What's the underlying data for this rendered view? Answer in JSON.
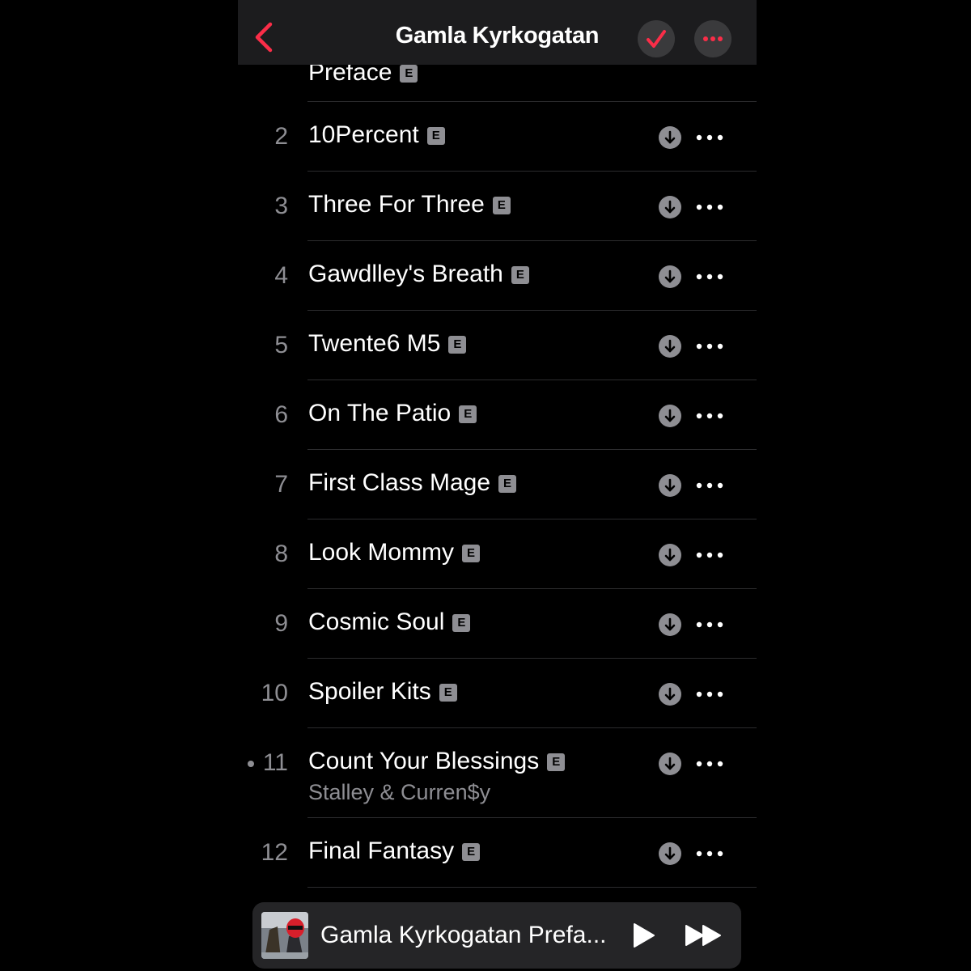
{
  "colors": {
    "accent": "#fa2d48",
    "secondary_text": "#8e8e93",
    "nav_bg": "#1c1c1e"
  },
  "nav": {
    "title": "Gamla Kyrkogatan",
    "back_icon": "chevron-left-icon",
    "check_icon": "checkmark-icon",
    "more_icon": "ellipsis-icon"
  },
  "partial_track": {
    "title": "Preface",
    "explicit": "E"
  },
  "tracks": [
    {
      "number": "2",
      "title": "10Percent",
      "explicit": "E"
    },
    {
      "number": "3",
      "title": "Three For Three",
      "explicit": "E"
    },
    {
      "number": "4",
      "title": "Gawdlley's Breath",
      "explicit": "E"
    },
    {
      "number": "5",
      "title": "Twente6 M5",
      "explicit": "E"
    },
    {
      "number": "6",
      "title": "On The Patio",
      "explicit": "E"
    },
    {
      "number": "7",
      "title": "First Class Mage",
      "explicit": "E"
    },
    {
      "number": "8",
      "title": "Look Mommy",
      "explicit": "E"
    },
    {
      "number": "9",
      "title": "Cosmic Soul",
      "explicit": "E"
    },
    {
      "number": "10",
      "title": "Spoiler Kits",
      "explicit": "E"
    },
    {
      "number": "11",
      "title": "Count Your Blessings",
      "explicit": "E",
      "artist": "Stalley & Curren$y"
    },
    {
      "number": "12",
      "title": "Final Fantasy",
      "explicit": "E"
    }
  ],
  "mini_player": {
    "title": "Gamla Kyrkogatan Prefa...",
    "play_icon": "play-icon",
    "forward_icon": "fast-forward-icon"
  }
}
